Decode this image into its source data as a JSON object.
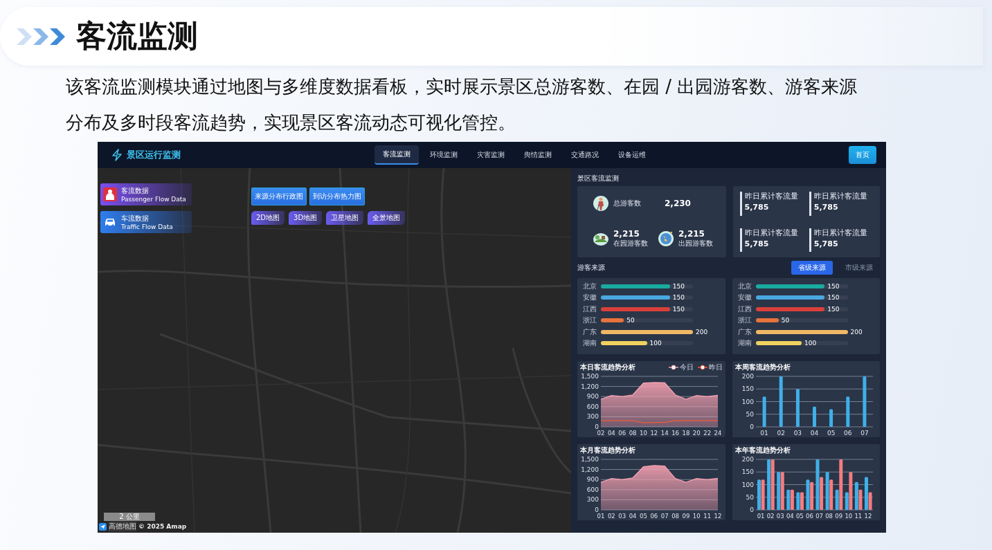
{
  "header": {
    "title": "客流监测"
  },
  "description": "该客流监测模块通过地图与多维度数据看板，实时展示景区总游客数、在园 / 出园游客数、游客来源分布及多时段客流趋势，实现景区客流动态可视化管控。",
  "dashboard": {
    "app_title": "景区运行监测",
    "nav": [
      {
        "label": "客流监测",
        "selected": true
      },
      {
        "label": "环境监测",
        "selected": false
      },
      {
        "label": "灾害监测",
        "selected": false
      },
      {
        "label": "舆情监测",
        "selected": false
      },
      {
        "label": "交通路况",
        "selected": false
      },
      {
        "label": "设备运维",
        "selected": false
      }
    ],
    "home_button": "首页",
    "map": {
      "data_buttons": [
        {
          "title": "客流数据",
          "subtitle": "Passenger Flow Data",
          "kind": "passenger"
        },
        {
          "title": "车流数据",
          "subtitle": "Traffic Flow Data",
          "kind": "vehicle"
        }
      ],
      "layer_buttons": [
        "来源分布行政图",
        "到访分布热力图"
      ],
      "map_types": [
        "2D地图",
        "3D地图",
        "卫星地图",
        "全景地图"
      ],
      "scale": "2 公里",
      "provider": "高德地图",
      "copyright": "© 2025 Amap"
    },
    "panel": {
      "title": "景区客流监测",
      "visitor_stats": [
        {
          "label": "总游客数",
          "value": "2,230",
          "kind": "hiker"
        },
        {
          "label": "在园游客数",
          "value": "2,215",
          "kind": "park"
        },
        {
          "label": "出园游客数",
          "value": "2,215",
          "kind": "globe"
        }
      ],
      "cumulative": [
        {
          "label": "昨日累计客流量",
          "value": "5,785"
        },
        {
          "label": "昨日累计客流量",
          "value": "5,785"
        },
        {
          "label": "昨日累计客流量",
          "value": "5,785"
        },
        {
          "label": "昨日累计客流量",
          "value": "5,785"
        }
      ],
      "sources": {
        "title": "游客来源",
        "tabs": [
          {
            "label": "省级来源",
            "selected": true
          },
          {
            "label": "市级来源",
            "selected": false
          }
        ],
        "lists": [
          [
            {
              "name": "北京",
              "value": "150",
              "level": 0.75,
              "color": "#1aaba0"
            },
            {
              "name": "安徽",
              "value": "150",
              "level": 0.75,
              "color": "#4aa8e0"
            },
            {
              "name": "江西",
              "value": "150",
              "level": 0.75,
              "color": "#d9403a"
            },
            {
              "name": "浙江",
              "value": "50",
              "level": 0.25,
              "color": "#e8733c"
            },
            {
              "name": "广东",
              "value": "200",
              "level": 1,
              "color": "#f0b865"
            },
            {
              "name": "湖南",
              "value": "100",
              "level": 0.5,
              "color": "#f0d060"
            }
          ],
          [
            {
              "name": "北京",
              "value": "150",
              "level": 0.75,
              "color": "#1aaba0"
            },
            {
              "name": "安徽",
              "value": "150",
              "level": 0.75,
              "color": "#4aa8e0"
            },
            {
              "name": "江西",
              "value": "150",
              "level": 0.75,
              "color": "#d9403a"
            },
            {
              "name": "浙江",
              "value": "50",
              "level": 0.25,
              "color": "#e8733c"
            },
            {
              "name": "广东",
              "value": "200",
              "level": 1,
              "color": "#f0b865"
            },
            {
              "name": "湖南",
              "value": "100",
              "level": 0.5,
              "color": "#f0d060"
            }
          ]
        ]
      },
      "charts": [
        {
          "chart_data": {
            "type": "area",
            "title": "本日客流趋势分析",
            "categories": [
              "02",
              "04",
              "06",
              "08",
              "10",
              "12",
              "14",
              "16",
              "18",
              "20",
              "22",
              "24"
            ],
            "series": [
              {
                "name": "今日",
                "color": "#f4a0b0",
                "values": [
                  820,
                  930,
                  900,
                  950,
                  1300,
                  1320,
                  1310,
                  950,
                  820,
                  930,
                  900,
                  940
                ]
              },
              {
                "name": "昨日",
                "type": "line",
                "color": "#f05a3a",
                "values": [
                  190,
                  190,
                  190,
                  190,
                  120,
                  130,
                  130,
                  190,
                  180,
                  190,
                  190,
                  190
                ]
              }
            ],
            "ylim": [
              0,
              1500
            ],
            "yticks": [
              {
                "value": 0,
                "label": "0"
              },
              {
                "value": 300,
                "label": "300"
              },
              {
                "value": 600,
                "label": "600"
              },
              {
                "value": 900,
                "label": "900"
              },
              {
                "value": 1200,
                "label": "1,200"
              },
              {
                "value": 1500,
                "label": "1,500"
              }
            ],
            "grid": true
          }
        },
        {
          "chart_data": {
            "type": "bar",
            "title": "本周客流趋势分析",
            "categories": [
              "01",
              "02",
              "03",
              "04",
              "05",
              "06",
              "07"
            ],
            "series": [
              {
                "color": "#3fb0e8",
                "values": [
                  120,
                  200,
                  150,
                  80,
                  70,
                  120,
                  200
                ]
              }
            ],
            "ylim": [
              0,
              200
            ],
            "yticks": [
              0,
              50,
              100,
              150,
              200
            ],
            "grid": true
          }
        },
        {
          "chart_data": {
            "type": "area",
            "title": "本月客流趋势分析",
            "categories": [
              "01",
              "02",
              "03",
              "04",
              "05",
              "06",
              "07",
              "08",
              "09",
              "10",
              "11",
              "12"
            ],
            "series": [
              {
                "color": "#f4a0b0",
                "values": [
                  820,
                  930,
                  900,
                  950,
                  1280,
                  1320,
                  1300,
                  930,
                  820,
                  930,
                  900,
                  940
                ]
              }
            ],
            "ylim": [
              0,
              1500
            ],
            "yticks": [
              {
                "value": 0,
                "label": "0"
              },
              {
                "value": 300,
                "label": "300"
              },
              {
                "value": 600,
                "label": "600"
              },
              {
                "value": 900,
                "label": "900"
              },
              {
                "value": 1200,
                "label": "1,200"
              },
              {
                "value": 1500,
                "label": "1,500"
              }
            ],
            "grid": true
          }
        },
        {
          "chart_data": {
            "type": "bar",
            "title": "本年客流趋势分析",
            "categories": [
              "01",
              "02",
              "03",
              "04",
              "05",
              "06",
              "07",
              "08",
              "09",
              "10",
              "11",
              "12"
            ],
            "series": [
              {
                "color": "#3fb0e8",
                "values": [
                  120,
                  200,
                  150,
                  80,
                  70,
                  120,
                  200,
                  150,
                  80,
                  70,
                  110,
                  130
                ]
              },
              {
                "color": "#f47c80",
                "values": [
                  120,
                  200,
                  150,
                  80,
                  70,
                  110,
                  130,
                  120,
                  200,
                  150,
                  80,
                  70
                ]
              }
            ],
            "ylim": [
              0,
              200
            ],
            "yticks": [
              0,
              50,
              100,
              150,
              200
            ],
            "grid": true
          }
        }
      ]
    }
  }
}
